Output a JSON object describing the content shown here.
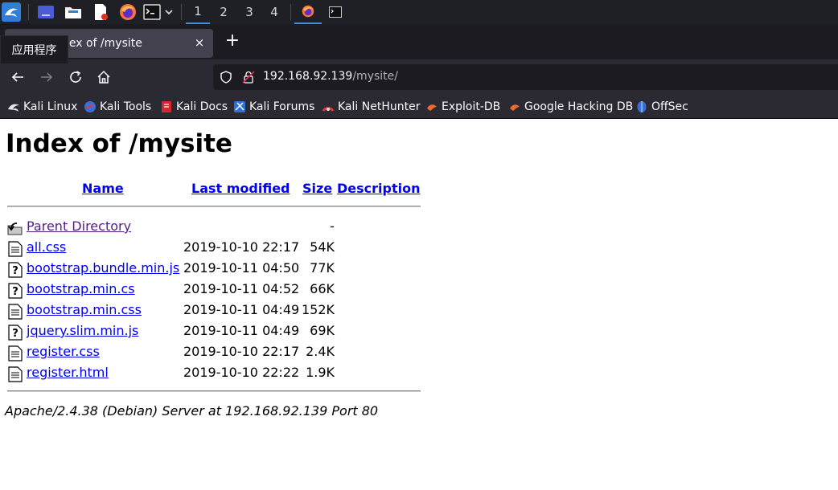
{
  "taskbar": {
    "workspaces": [
      "1",
      "2",
      "3",
      "4"
    ],
    "active_workspace": "1",
    "accent": "#3b8fe6"
  },
  "browser": {
    "tab_title": "Index of /mysite",
    "tab_close": "×",
    "new_tab": "+",
    "tooltip": "应用程序",
    "url_host": "192.168.92.139",
    "url_path": "/mysite/"
  },
  "bookmarks": [
    {
      "label": "Kali Linux",
      "icon": "kali-dragon-icon"
    },
    {
      "label": "Kali Tools",
      "icon": "kali-tools-icon"
    },
    {
      "label": "Kali Docs",
      "icon": "kali-docs-icon"
    },
    {
      "label": "Kali Forums",
      "icon": "kali-forums-icon"
    },
    {
      "label": "Kali NetHunter",
      "icon": "nethunter-icon"
    },
    {
      "label": "Exploit-DB",
      "icon": "exploit-db-icon"
    },
    {
      "label": "Google Hacking DB",
      "icon": "ghdb-icon"
    },
    {
      "label": "OffSec",
      "icon": "offsec-icon"
    }
  ],
  "page": {
    "title": "Index of /mysite",
    "columns": {
      "name": "Name",
      "last_modified": "Last modified",
      "size": "Size",
      "description": "Description"
    },
    "rows": [
      {
        "name": "Parent Directory",
        "date": "",
        "size": "-",
        "icon": "back-folder-icon",
        "visited": true
      },
      {
        "name": "all.css",
        "date": "2019-10-10 22:17",
        "size": "54K",
        "icon": "text-file-icon",
        "visited": false
      },
      {
        "name": "bootstrap.bundle.min.js",
        "date": "2019-10-11 04:50",
        "size": "77K",
        "icon": "unknown-file-icon",
        "visited": false
      },
      {
        "name": "bootstrap.min.cs",
        "date": "2019-10-11 04:52",
        "size": "66K",
        "icon": "unknown-file-icon",
        "visited": false
      },
      {
        "name": "bootstrap.min.css",
        "date": "2019-10-11 04:49",
        "size": "152K",
        "icon": "text-file-icon",
        "visited": false
      },
      {
        "name": "jquery.slim.min.js",
        "date": "2019-10-11 04:49",
        "size": "69K",
        "icon": "unknown-file-icon",
        "visited": false
      },
      {
        "name": "register.css",
        "date": "2019-10-10 22:17",
        "size": "2.4K",
        "icon": "text-file-icon",
        "visited": false
      },
      {
        "name": "register.html",
        "date": "2019-10-10 22:22",
        "size": "1.9K",
        "icon": "text-file-icon",
        "visited": false
      }
    ],
    "server_signature": "Apache/2.4.38 (Debian) Server at 192.168.92.139 Port 80"
  }
}
